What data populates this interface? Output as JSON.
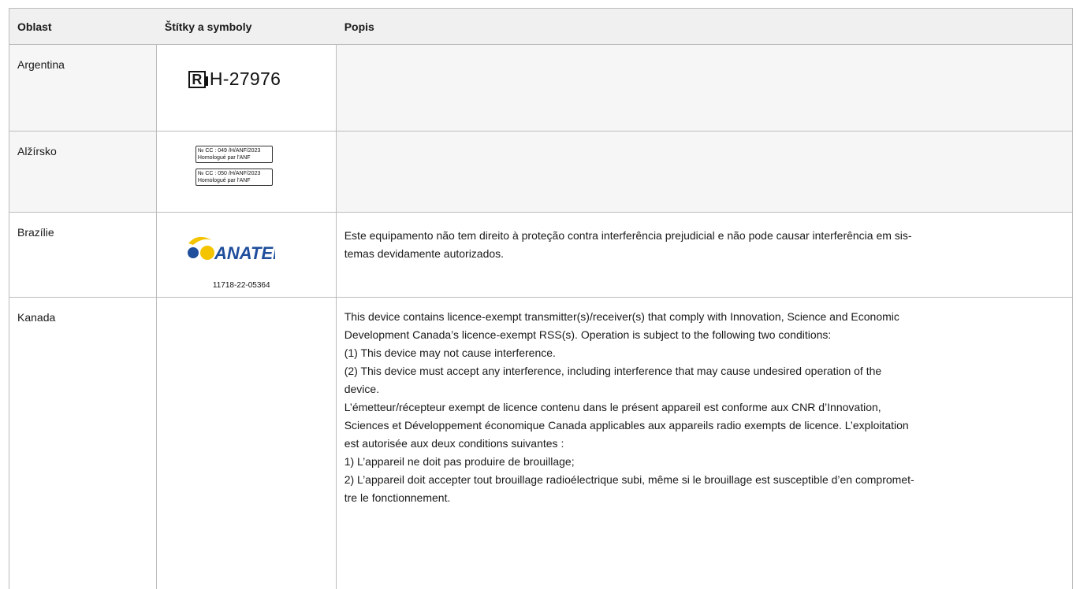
{
  "table": {
    "headers": [
      "Oblast",
      "Štítky a symboly",
      "Popis"
    ],
    "rows": [
      {
        "region": "Argentina",
        "symbol": {
          "type": "argentina-mark",
          "letter": "R",
          "number": "H-27976"
        },
        "description": []
      },
      {
        "region": "Alžírsko",
        "symbol": {
          "type": "algeria-labels",
          "labels": [
            {
              "line1": "№ CC : 049 /H/ANF/2023",
              "line2": "Homologué par l'ANF"
            },
            {
              "line1": "№ CC : 050 /H/ANF/2023",
              "line2": "Homologué par l'ANF"
            }
          ]
        },
        "description": []
      },
      {
        "region": "Brazílie",
        "symbol": {
          "type": "anatel-logo",
          "brand": "ANATEL",
          "code": "11718-22-05364"
        },
        "description": [
          "Este equipamento não tem direito à proteção contra interferência prejudicial e não pode causar interferência em sis-",
          "temas devidamente autorizados."
        ]
      },
      {
        "region": "Kanada",
        "symbol": null,
        "description": [
          "This device contains licence-exempt transmitter(s)/receiver(s) that comply with Innovation, Science and Economic",
          "Development Canada’s licence-exempt RSS(s). Operation is subject to the following two conditions:",
          "(1) This device may not cause interference.",
          "(2) This device must accept any interference, including interference that may cause undesired operation of the",
          "device.",
          "L’émetteur/récepteur exempt de licence contenu dans le présent appareil est conforme aux CNR d’Innovation,",
          "Sciences et Développement économique Canada applicables aux appareils radio exempts de licence. L’exploitation",
          "est autorisée aux deux conditions suivantes :",
          "1) L’appareil ne doit pas produire de brouillage;",
          "2) L’appareil doit accepter tout brouillage radioélectrique subi, même si le brouillage est susceptible d’en compromet-",
          "tre le fonctionnement."
        ]
      }
    ]
  },
  "colors": {
    "header_bg": "#f0f0f0",
    "row_bg": "#f6f6f6",
    "border": "#bcbcbc",
    "anatel_blue": "#1f4e9c",
    "anatel_yellow": "#f5c400"
  }
}
